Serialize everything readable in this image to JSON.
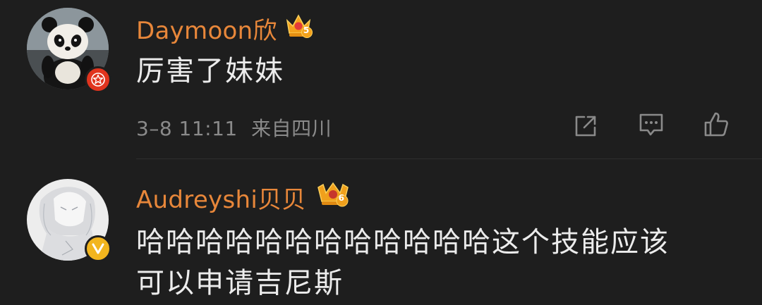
{
  "comments": [
    {
      "username": "Daymoon欣",
      "level": "5",
      "text": "厉害了妹妹",
      "timestamp": "3–8 11:11",
      "location": "来自四川",
      "badge_icon": "red-star-badge-icon",
      "crown_icon": "vip-crown-icon"
    },
    {
      "username": "Audreyshi贝贝",
      "level": "6",
      "text_line1": "哈哈哈哈哈哈哈哈哈哈哈哈这个技能应该",
      "text_line2": "可以申请吉尼斯",
      "badge_icon": "verified-v-badge-icon",
      "crown_icon": "vip-crown-icon"
    }
  ],
  "colors": {
    "background": "#1e1e1e",
    "username": "#e8873a",
    "text": "#ececec",
    "meta": "#8a8a8a",
    "badge_red": "#e0341e",
    "badge_gold": "#f2b51e"
  }
}
